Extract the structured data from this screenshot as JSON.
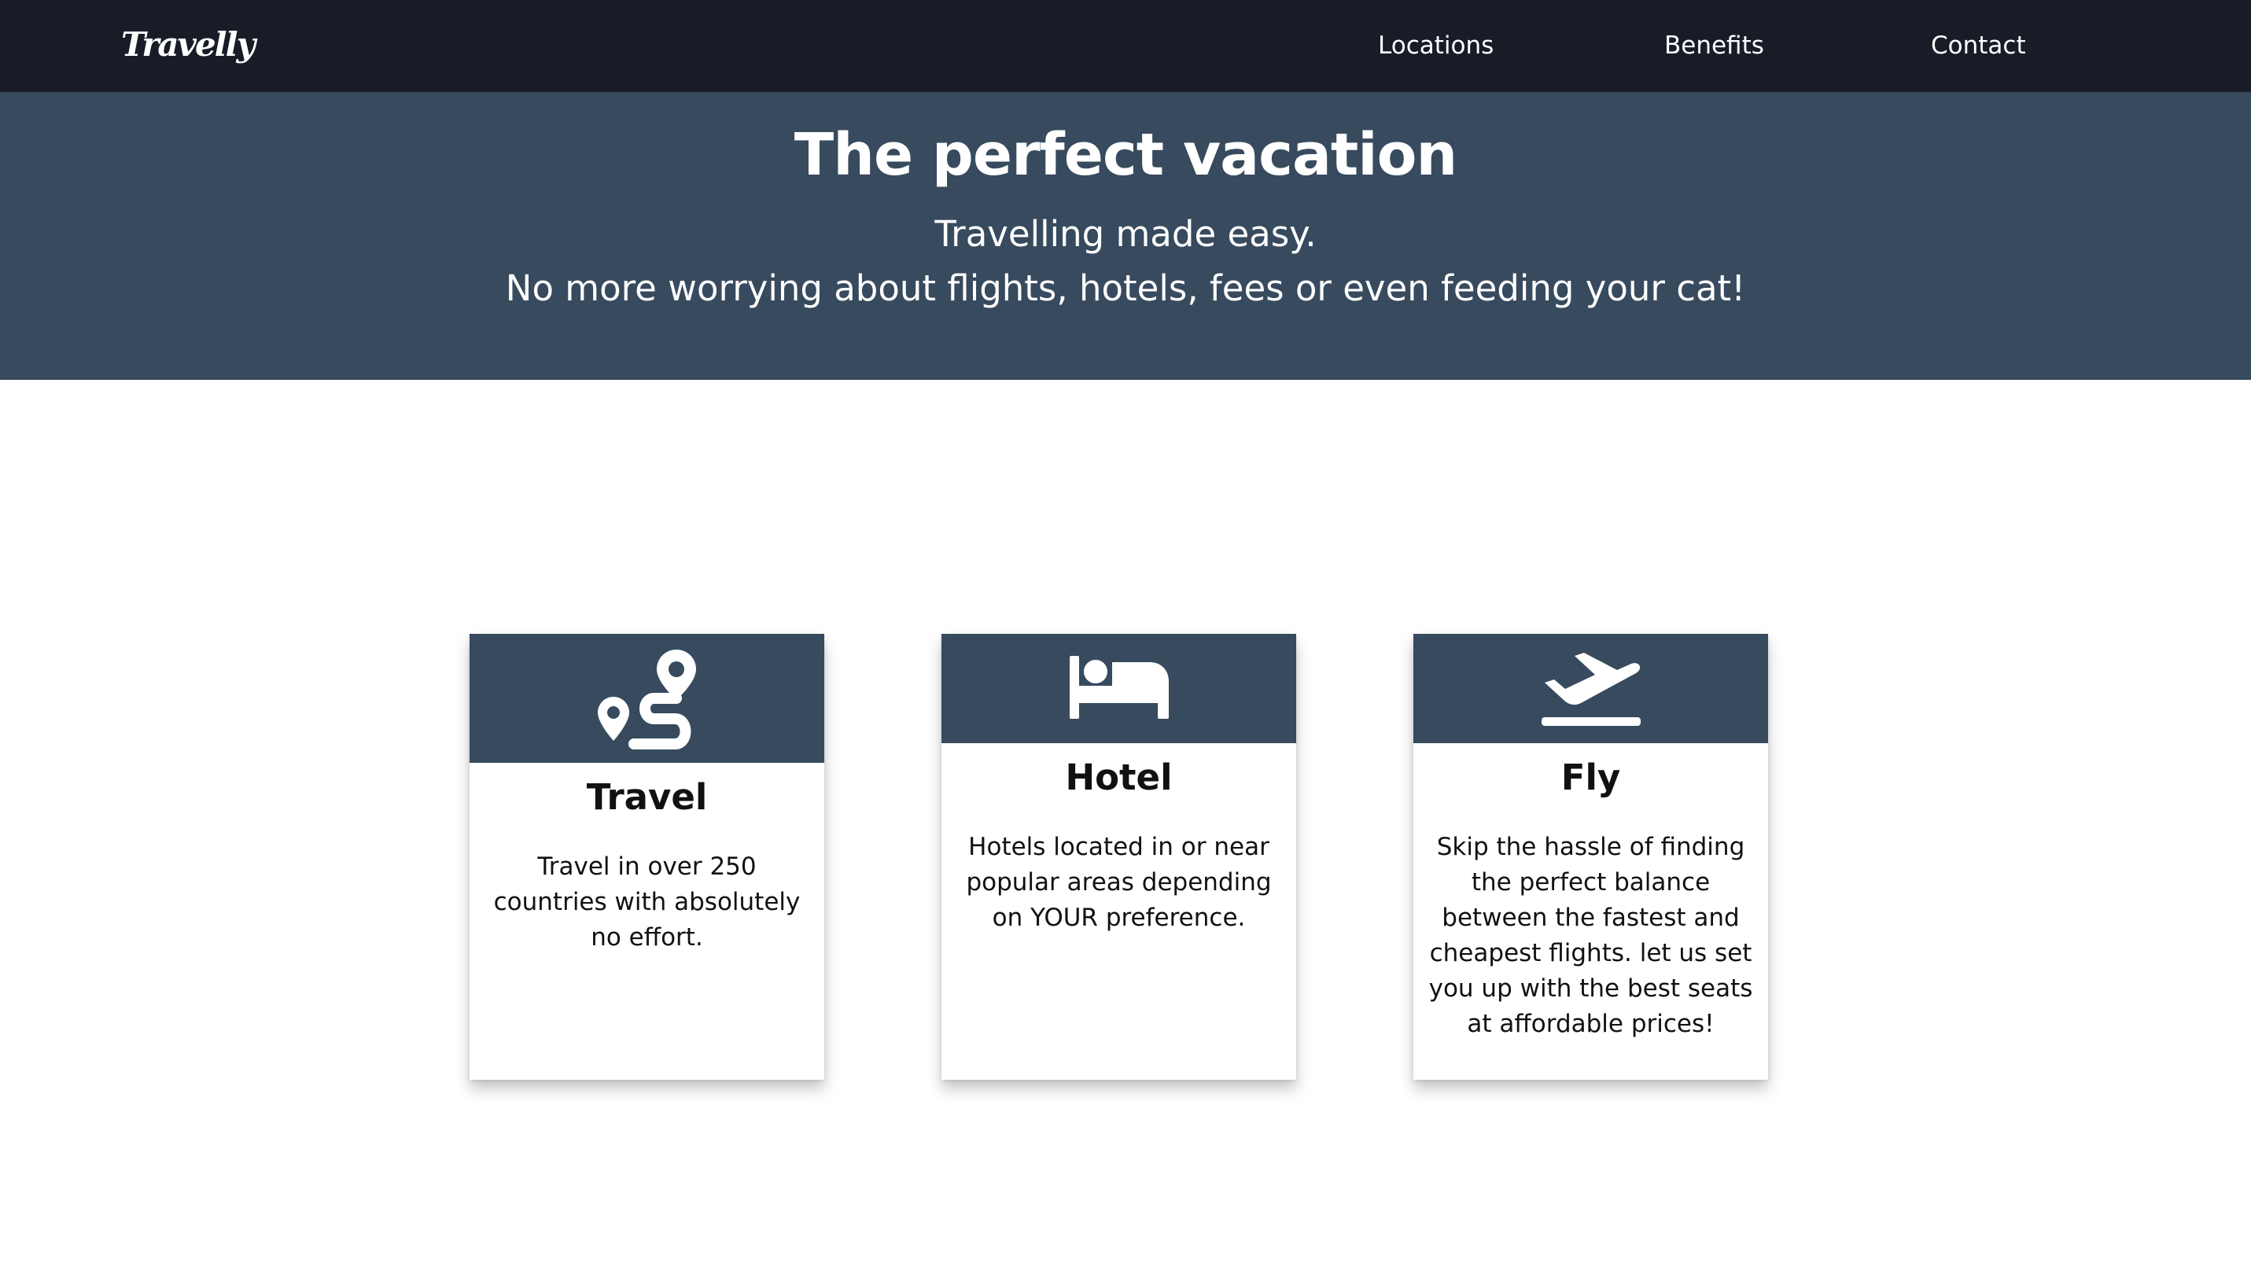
{
  "brand": {
    "logo_text": "Travelly"
  },
  "nav": {
    "links": [
      {
        "label": "Locations"
      },
      {
        "label": "Benefits"
      },
      {
        "label": "Contact"
      }
    ]
  },
  "hero": {
    "title": "The perfect vacation",
    "subtitle_line1": "Travelling made easy.",
    "subtitle_line2": "No more worrying about flights, hotels, fees or even feeding your cat!"
  },
  "cards": [
    {
      "icon": "route-icon",
      "title": "Travel",
      "text": "Travel in over 250 countries with absolutely no effort."
    },
    {
      "icon": "bed-icon",
      "title": "Hotel",
      "text": "Hotels located in or near popular areas depending on YOUR preference."
    },
    {
      "icon": "plane-departure-icon",
      "title": "Fly",
      "text": "Skip the hassle of finding the perfect balance between the fastest and cheapest flights. let us set you up with the best seats at affordable prices!"
    }
  ],
  "colors": {
    "navbar_bg": "#171c27",
    "hero_bg": "#374a5e",
    "card_header_bg": "#374a5e",
    "text_light": "#ffffff",
    "text_dark": "#111111"
  }
}
